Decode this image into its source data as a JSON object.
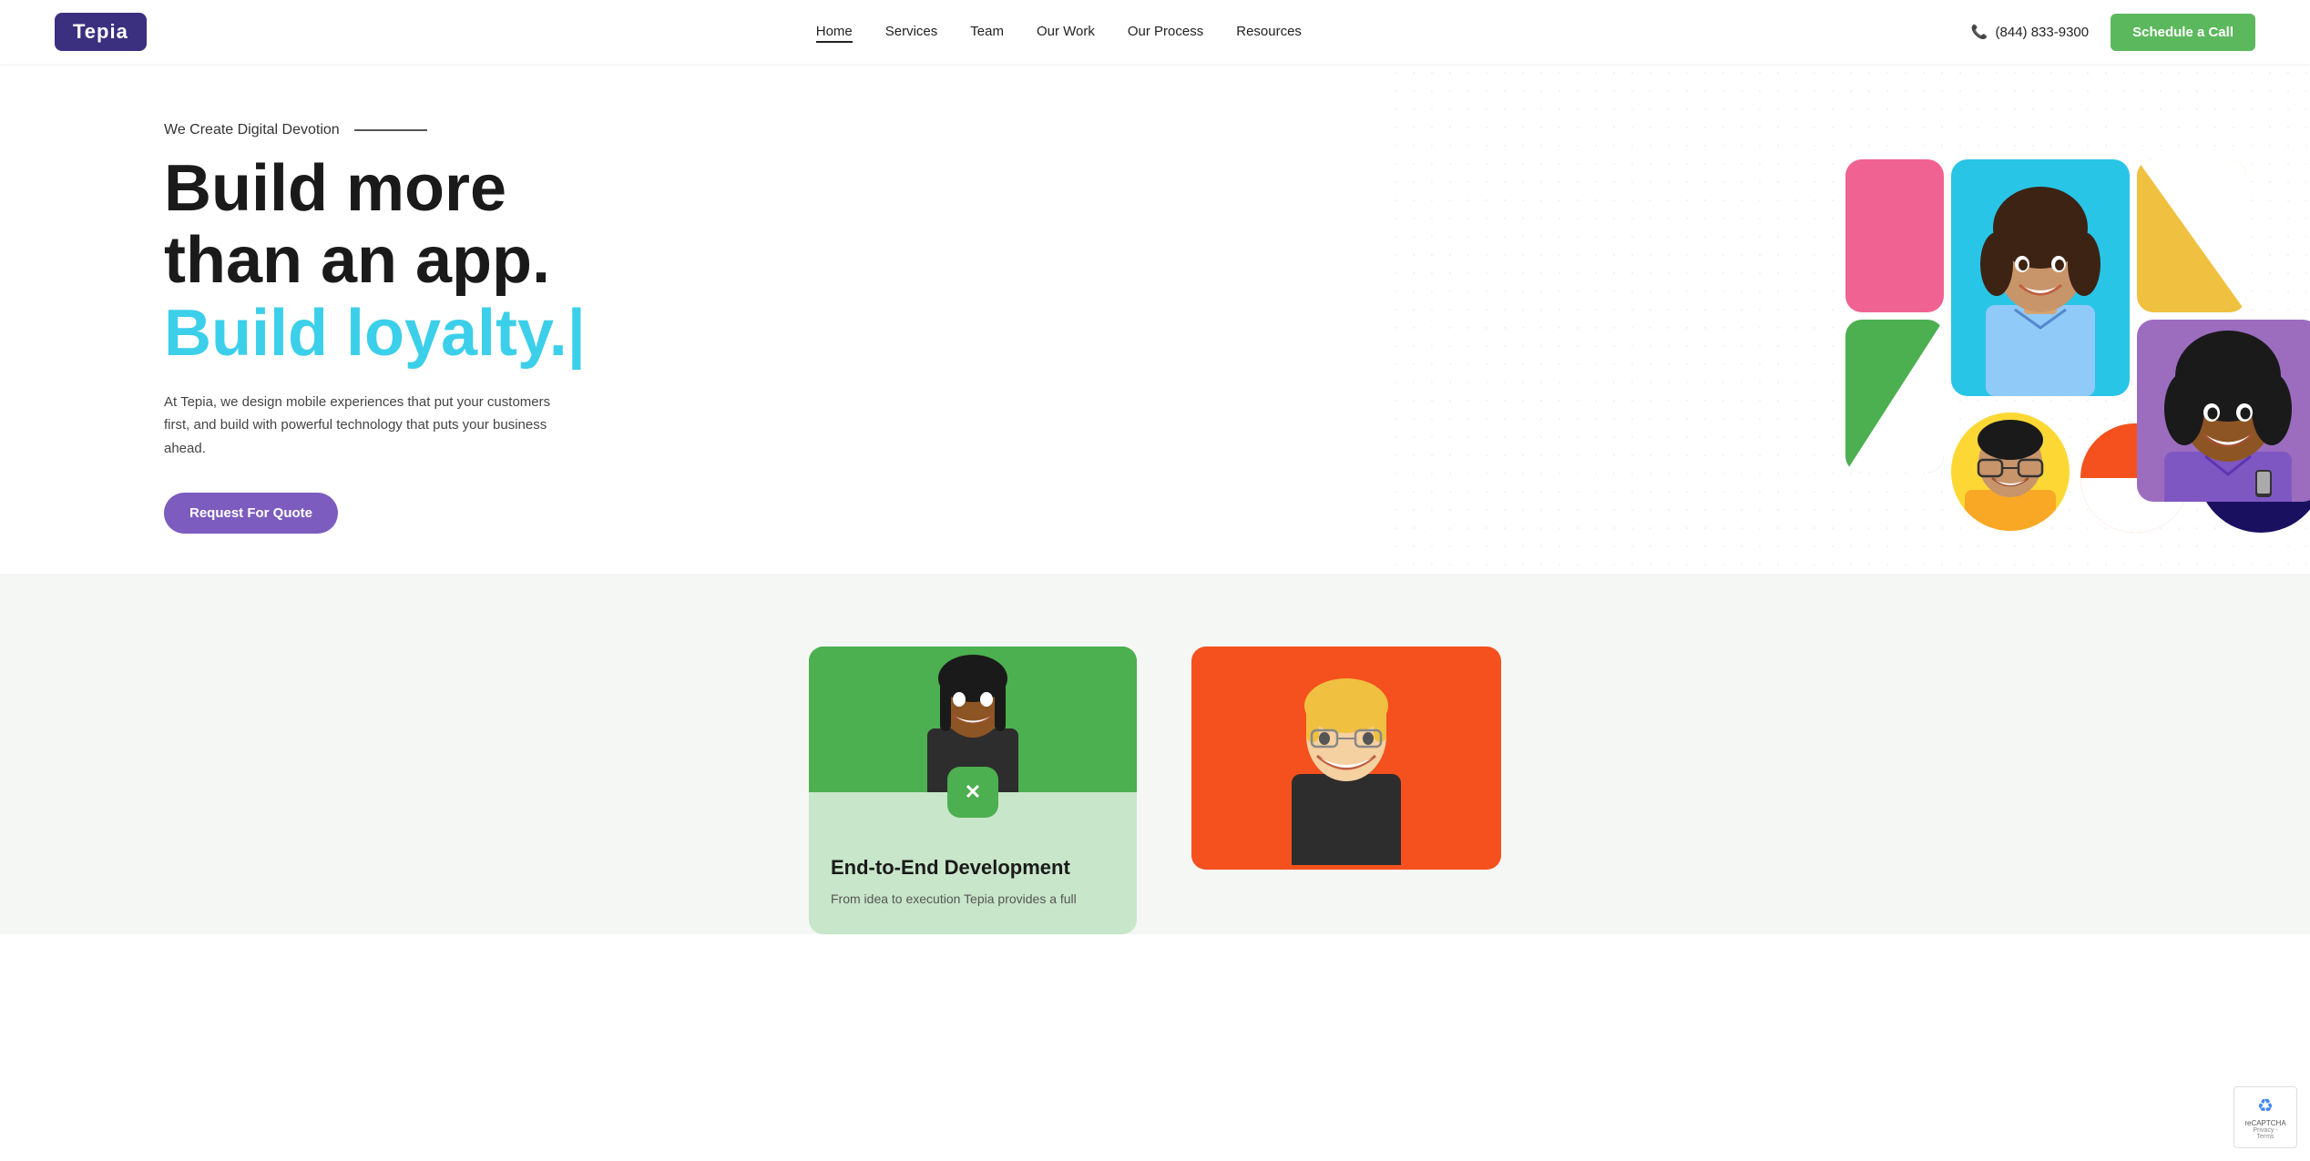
{
  "nav": {
    "logo": "Tepia",
    "links": [
      {
        "label": "Home",
        "active": true
      },
      {
        "label": "Services",
        "active": false
      },
      {
        "label": "Team",
        "active": false
      },
      {
        "label": "Our Work",
        "active": false
      },
      {
        "label": "Our Process",
        "active": false
      },
      {
        "label": "Resources",
        "active": false
      }
    ],
    "phone": "(844) 833-9300",
    "schedule_cta": "Schedule a Call"
  },
  "hero": {
    "tagline": "We Create Digital Devotion",
    "title_line1": "Build more",
    "title_line2": "than an app.",
    "title_line3": "Build loyalty.|",
    "description": "At Tepia, we design mobile experiences that put your customers first, and build with powerful technology that puts your business ahead.",
    "cta_label": "Request For Quote"
  },
  "bottom": {
    "card1": {
      "icon": "✕",
      "title": "End-to-End Development",
      "desc": "From idea to execution Tepia provides a full"
    },
    "card2": {}
  },
  "recaptcha": {
    "label": "reCAPTCHA",
    "sub": "Privacy - Terms"
  }
}
